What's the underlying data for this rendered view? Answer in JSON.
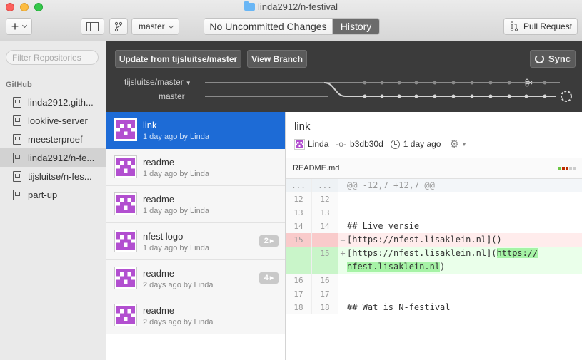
{
  "window": {
    "title": "linda2912/n-festival"
  },
  "toolbar": {
    "add_label": "+",
    "branch_label": "master",
    "tabs": [
      {
        "label": "No Uncommitted Changes",
        "selected": false
      },
      {
        "label": "History",
        "selected": true
      }
    ],
    "pull_request_label": "Pull Request"
  },
  "sidebar": {
    "filter_placeholder": "Filter Repositories",
    "section": "GitHub",
    "repos": [
      {
        "name": "linda2912.gith...",
        "selected": false
      },
      {
        "name": "looklive-server",
        "selected": false
      },
      {
        "name": "meesterproef",
        "selected": false
      },
      {
        "name": "linda2912/n-fe...",
        "selected": true
      },
      {
        "name": "tijsluitse/n-fes...",
        "selected": false
      },
      {
        "name": "part-up",
        "selected": false
      }
    ]
  },
  "header": {
    "update_label": "Update from tijsluitse/master",
    "view_branch_label": "View Branch",
    "sync_label": "Sync",
    "branches": [
      {
        "name": "tijsluitse/master",
        "dropdown": true
      },
      {
        "name": "master",
        "dropdown": false
      }
    ]
  },
  "commits": [
    {
      "title": "link",
      "meta": "1 day ago by Linda",
      "badge": "",
      "selected": true
    },
    {
      "title": "readme",
      "meta": "1 day ago by Linda",
      "badge": "",
      "selected": false
    },
    {
      "title": "readme",
      "meta": "1 day ago by Linda",
      "badge": "",
      "selected": false
    },
    {
      "title": "nfest logo",
      "meta": "1 day ago by Linda",
      "badge": "2",
      "selected": false
    },
    {
      "title": "readme",
      "meta": "2 days ago by Linda",
      "badge": "4",
      "selected": false
    },
    {
      "title": "readme",
      "meta": "2 days ago by Linda",
      "badge": "",
      "selected": false
    }
  ],
  "detail": {
    "title": "link",
    "author": "Linda",
    "sha": "b3db30d",
    "time": "1 day ago",
    "file": "README.md",
    "diff": [
      {
        "type": "hunk",
        "old": "...",
        "new": "...",
        "text": "@@ -12,7 +12,7 @@"
      },
      {
        "type": "ctx",
        "old": "12",
        "new": "12",
        "text": ""
      },
      {
        "type": "ctx",
        "old": "13",
        "new": "13",
        "text": ""
      },
      {
        "type": "ctx",
        "old": "14",
        "new": "14",
        "text": "## Live versie"
      },
      {
        "type": "del",
        "old": "15",
        "new": "",
        "text": "[https://nfest.lisaklein.nl]()"
      },
      {
        "type": "add",
        "old": "",
        "new": "15",
        "text_a": "[https://nfest.lisaklein.nl](",
        "text_b": "https://",
        "text_c": "nfest.lisaklein.nl",
        "text_d": ")"
      },
      {
        "type": "ctx",
        "old": "16",
        "new": "16",
        "text": ""
      },
      {
        "type": "ctx",
        "old": "17",
        "new": "17",
        "text": ""
      },
      {
        "type": "ctx",
        "old": "18",
        "new": "18",
        "text": "## Wat is N-festival"
      }
    ]
  },
  "colors": {
    "accent": "#1d6bd6",
    "avatar": "#b24fd0",
    "deleted": "#ffecec",
    "added": "#eaffea",
    "dark_header": "#3b3b3b"
  }
}
